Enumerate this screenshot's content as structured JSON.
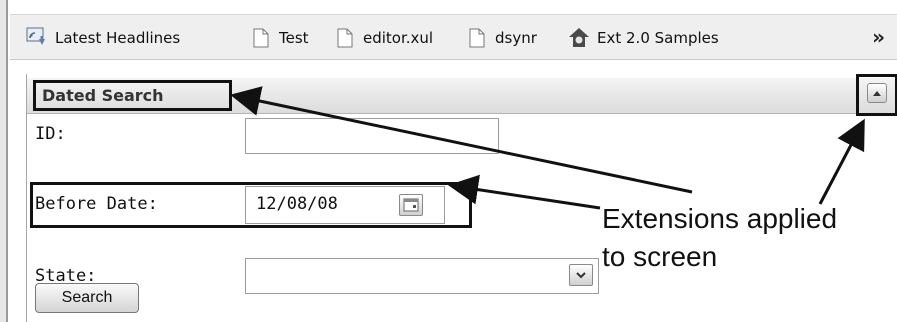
{
  "toolbar": {
    "bookmarks": [
      {
        "label": "Latest Headlines",
        "icon": "rss-feed-icon"
      },
      {
        "label": "Test",
        "icon": "page-icon"
      },
      {
        "label": "editor.xul",
        "icon": "page-icon"
      },
      {
        "label": "dsynr",
        "icon": "page-icon"
      },
      {
        "label": "Ext 2.0 Samples",
        "icon": "ext-logo-icon"
      }
    ],
    "overflow_label": "»"
  },
  "panel": {
    "title": "Dated Search",
    "collapse_icon": "collapse-up-icon",
    "fields": {
      "id_label": "ID:",
      "id_value": "",
      "before_date_label": "Before Date:",
      "before_date_value": "12/08/08",
      "state_label": "State:",
      "state_value": ""
    },
    "search_button": "Search"
  },
  "annotation": {
    "line1": "Extensions applied",
    "line2": "to screen"
  },
  "colors": {
    "toolbar_bg": "#efefef",
    "header_gradient_top": "#f4f4f4",
    "header_gradient_bottom": "#dcdcdc",
    "callout_border": "#111111"
  }
}
